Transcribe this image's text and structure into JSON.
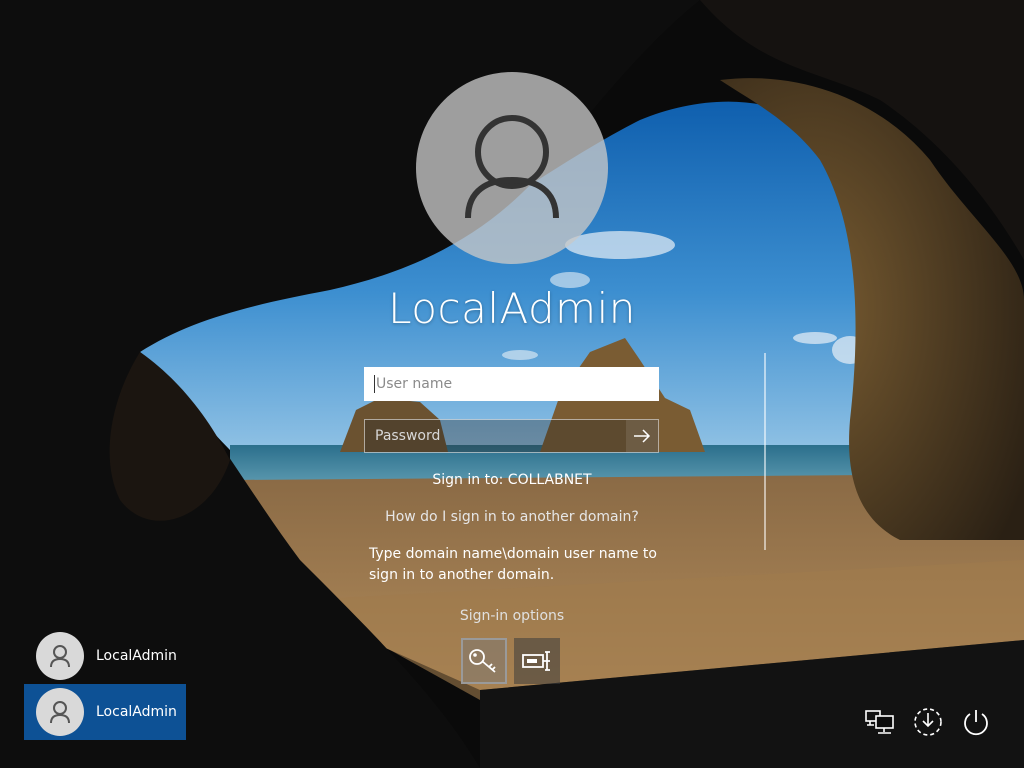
{
  "user": {
    "display_name": "LocalAdmin"
  },
  "fields": {
    "username_placeholder": "User name",
    "username_value": "",
    "password_placeholder": "Password",
    "password_value": ""
  },
  "signin_target": "Sign in to: COLLABNET",
  "other_domain_link": "How do I sign in to another domain?",
  "domain_help": "Type domain name\\domain user name to sign in to another domain.",
  "signin_options_label": "Sign-in options",
  "signin_options": [
    {
      "icon": "key-icon",
      "selected": true
    },
    {
      "icon": "smart-card-icon",
      "selected": false
    }
  ],
  "user_tiles": [
    {
      "name": "LocalAdmin",
      "selected": false
    },
    {
      "name": "LocalAdmin",
      "selected": true
    }
  ],
  "system_icons": [
    "network-icon",
    "ease-of-access-icon",
    "power-icon"
  ],
  "colors": {
    "selected_tile": "#0d5195",
    "avatar_bg": "#c8c8c8"
  }
}
